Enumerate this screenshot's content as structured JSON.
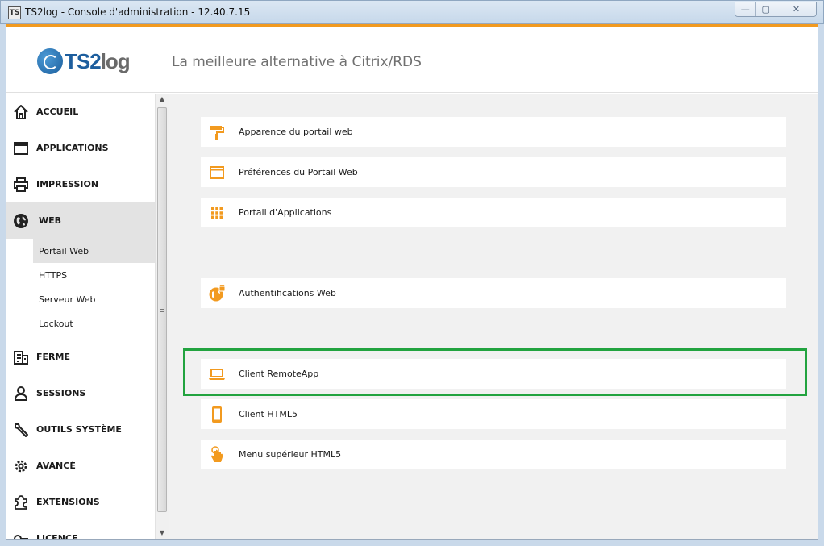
{
  "window": {
    "title": "TS2log - Console d'administration - 12.40.7.15",
    "app_icon": "TS",
    "controls": {
      "minimize": "—",
      "maximize": "▢",
      "close": "✕"
    }
  },
  "header": {
    "logo_ts": "TS2",
    "logo_log": "log",
    "tagline": "La meilleure alternative à Citrix/RDS"
  },
  "colors": {
    "accent": "#f29a1f",
    "icon": "#f29a1f",
    "highlight": "#22a33f",
    "logo_blue": "#1d5e9e"
  },
  "sidebar": {
    "items": [
      {
        "label": "ACCUEIL",
        "icon": "home-icon"
      },
      {
        "label": "APPLICATIONS",
        "icon": "window-icon"
      },
      {
        "label": "IMPRESSION",
        "icon": "printer-icon"
      },
      {
        "label": "WEB",
        "icon": "globe-icon"
      },
      {
        "label": "FERME",
        "icon": "building-icon"
      },
      {
        "label": "SESSIONS",
        "icon": "user-icon"
      },
      {
        "label": "OUTILS SYSTÈME",
        "icon": "wrench-icon"
      },
      {
        "label": "AVANCÉ",
        "icon": "gear-icon"
      },
      {
        "label": "EXTENSIONS",
        "icon": "puzzle-icon"
      },
      {
        "label": "LICENCE",
        "icon": "key-icon"
      }
    ],
    "web_subitems": [
      {
        "label": "Portail Web"
      },
      {
        "label": "HTTPS"
      },
      {
        "label": "Serveur Web"
      },
      {
        "label": "Lockout"
      }
    ]
  },
  "scrollbar": {
    "up": "▲",
    "down": "▼"
  },
  "main": {
    "cards": [
      {
        "label": "Apparence du portail web",
        "icon": "paint-roller-icon"
      },
      {
        "label": "Préférences du Portail Web",
        "icon": "browser-window-icon"
      },
      {
        "label": "Portail d'Applications",
        "icon": "grid-icon"
      },
      {
        "label": "Authentifications Web",
        "icon": "globe-lock-icon"
      },
      {
        "label": "Client RemoteApp",
        "icon": "laptop-icon"
      },
      {
        "label": "Client HTML5",
        "icon": "smartphone-icon"
      },
      {
        "label": "Menu supérieur HTML5",
        "icon": "hand-pointer-icon"
      }
    ]
  }
}
